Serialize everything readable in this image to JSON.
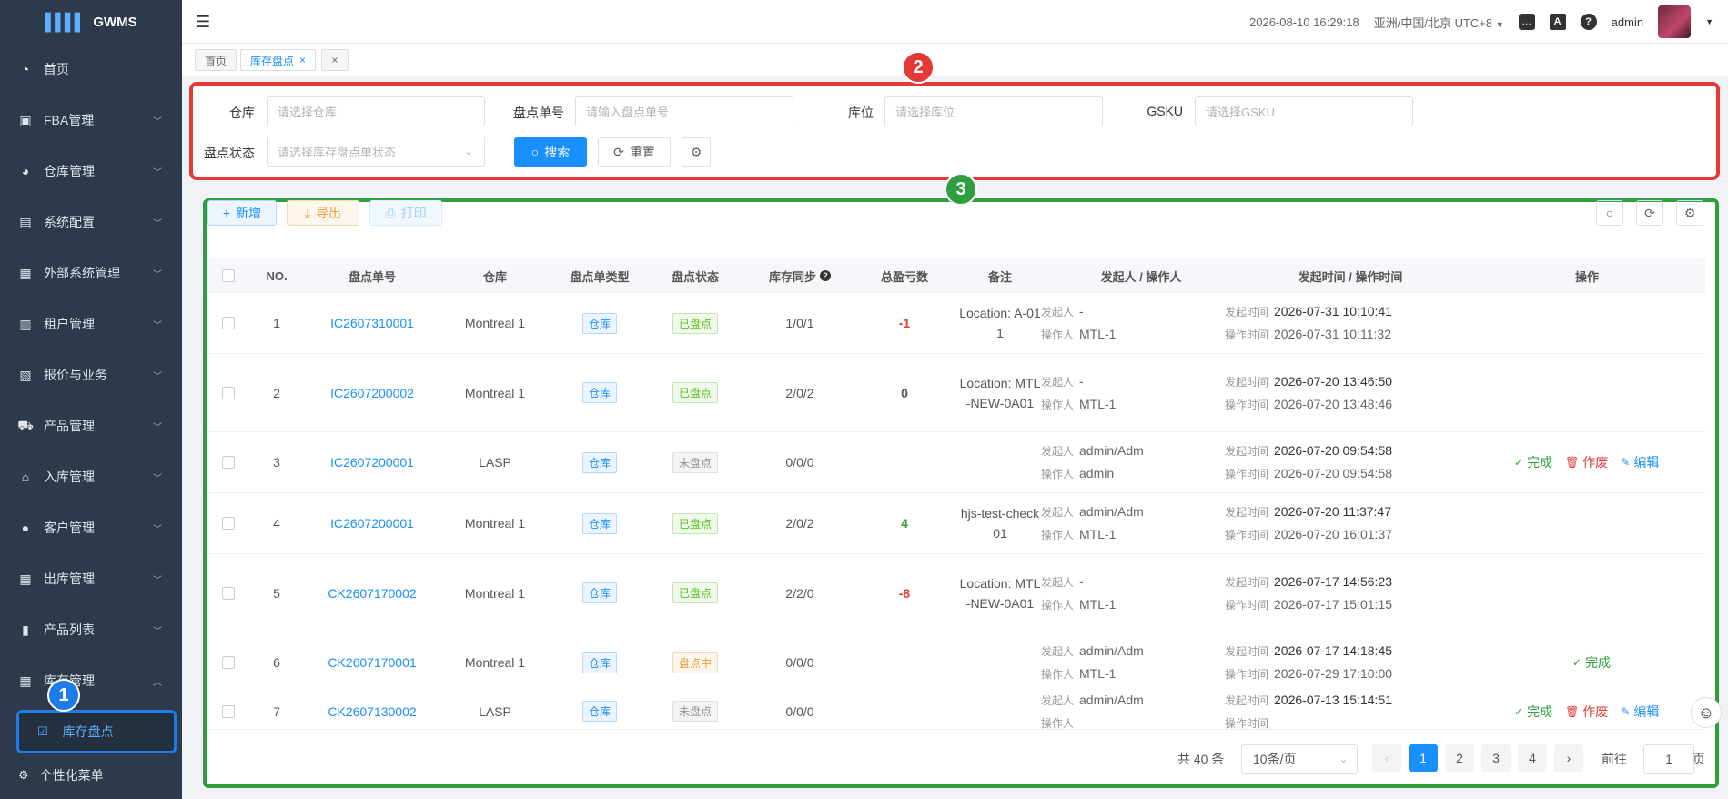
{
  "app": {
    "name": "GWMS"
  },
  "sidebar": {
    "items": [
      {
        "label": "首页",
        "icon": "dashboard-icon"
      },
      {
        "label": "FBA管理",
        "icon": "fba-icon"
      },
      {
        "label": "仓库管理",
        "icon": "warehouse-icon"
      },
      {
        "label": "系统配置",
        "icon": "config-icon"
      },
      {
        "label": "外部系统管理",
        "icon": "grid-icon"
      },
      {
        "label": "租户管理",
        "icon": "chart-icon"
      },
      {
        "label": "报价与业务",
        "icon": "quote-icon"
      },
      {
        "label": "产品管理",
        "icon": "cart-icon"
      },
      {
        "label": "入库管理",
        "icon": "home-icon"
      },
      {
        "label": "客户管理",
        "icon": "user-icon"
      },
      {
        "label": "出库管理",
        "icon": "grid-icon"
      },
      {
        "label": "产品列表",
        "icon": "book-icon"
      },
      {
        "label": "库存管理",
        "icon": "table-icon"
      }
    ],
    "active_sub": "库存盘点",
    "bottom": "个性化菜单"
  },
  "topbar": {
    "datetime": "2026-08-10 16:29:18",
    "timezone": "亚洲/中国/北京 UTC+8",
    "user": "admin"
  },
  "tabs": [
    {
      "label": "首页"
    },
    {
      "label": "库存盘点"
    }
  ],
  "annotations": [
    "1",
    "2",
    "3"
  ],
  "filters": {
    "warehouse_label": "仓库",
    "warehouse_ph": "请选择仓库",
    "order_label": "盘点单号",
    "order_ph": "请输入盘点单号",
    "location_label": "库位",
    "location_ph": "请选择库位",
    "gsku_label": "GSKU",
    "gsku_ph": "请选择GSKU",
    "status_label": "盘点状态",
    "status_ph": "请选择库存盘点单状态",
    "search": "搜索",
    "reset": "重置"
  },
  "toolbar": {
    "add": "新增",
    "export": "导出",
    "print": "打印"
  },
  "table": {
    "headers": [
      "NO.",
      "盘点单号",
      "仓库",
      "盘点单类型",
      "盘点状态",
      "库存同步",
      "总盈亏数",
      "备注",
      "发起人 / 操作人",
      "发起时间 / 操作时间",
      "操作"
    ],
    "initiator_key": "发起人",
    "operator_key": "操作人",
    "start_key": "发起时间",
    "op_key": "操作时间",
    "rows": [
      {
        "no": "1",
        "order": "IC2607310001",
        "warehouse": "Montreal 1",
        "type": "仓库",
        "status": "已盘点",
        "status_kind": "done",
        "sync": "1/0/1",
        "diff": "-1",
        "diff_color": "#e53935",
        "note": "Location: A-011",
        "initiator": "-",
        "operator": "MTL-1",
        "start": "2026-07-31 10:10:41",
        "op_time": "2026-07-31 10:11:32",
        "actions": []
      },
      {
        "no": "2",
        "order": "IC2607200002",
        "warehouse": "Montreal 1",
        "type": "仓库",
        "status": "已盘点",
        "status_kind": "done",
        "sync": "2/0/2",
        "diff": "0",
        "diff_color": "#555",
        "note": "Location: MTL-NEW-0A01",
        "initiator": "-",
        "operator": "MTL-1",
        "start": "2026-07-20 13:46:50",
        "op_time": "2026-07-20 13:48:46",
        "actions": []
      },
      {
        "no": "3",
        "order": "IC2607200001",
        "warehouse": "LASP",
        "type": "仓库",
        "status": "未盘点",
        "status_kind": "not",
        "sync": "0/0/0",
        "diff": "",
        "diff_color": "#555",
        "note": "",
        "initiator": "admin/Adm",
        "operator": "admin",
        "start": "2026-07-20 09:54:58",
        "op_time": "2026-07-20 09:54:58",
        "actions": [
          "完成",
          "作废",
          "编辑"
        ]
      },
      {
        "no": "4",
        "order": "IC2607200001",
        "warehouse": "Montreal 1",
        "type": "仓库",
        "status": "已盘点",
        "status_kind": "done",
        "sync": "2/0/2",
        "diff": "4",
        "diff_color": "#2e9e3e",
        "note": "hjs-test-check01",
        "initiator": "admin/Adm",
        "operator": "MTL-1",
        "start": "2026-07-20 11:37:47",
        "op_time": "2026-07-20 16:01:37",
        "actions": []
      },
      {
        "no": "5",
        "order": "CK2607170002",
        "warehouse": "Montreal 1",
        "type": "仓库",
        "status": "已盘点",
        "status_kind": "done",
        "sync": "2/2/0",
        "diff": "-8",
        "diff_color": "#e53935",
        "note": "Location: MTL-NEW-0A01",
        "initiator": "-",
        "operator": "MTL-1",
        "start": "2026-07-17 14:56:23",
        "op_time": "2026-07-17 15:01:15",
        "actions": []
      },
      {
        "no": "6",
        "order": "CK2607170001",
        "warehouse": "Montreal 1",
        "type": "仓库",
        "status": "盘点中",
        "status_kind": "ing",
        "sync": "0/0/0",
        "diff": "",
        "diff_color": "#555",
        "note": "",
        "initiator": "admin/Adm",
        "operator": "MTL-1",
        "start": "2026-07-17 14:18:45",
        "op_time": "2026-07-29 17:10:00",
        "actions": [
          "完成"
        ]
      },
      {
        "no": "7",
        "order": "CK2607130002",
        "warehouse": "LASP",
        "type": "仓库",
        "status": "未盘点",
        "status_kind": "not",
        "sync": "0/0/0",
        "diff": "",
        "diff_color": "#555",
        "note": "",
        "initiator": "admin/Adm",
        "operator": "",
        "start": "2026-07-13 15:14:51",
        "op_time": "",
        "actions": [
          "完成",
          "作废",
          "编辑"
        ]
      }
    ]
  },
  "pagination": {
    "total": "共 40 条",
    "page_size": "10条/页",
    "pages": [
      "1",
      "2",
      "3",
      "4"
    ],
    "goto_label": "前往",
    "goto_value": "1",
    "goto_suffix": "页"
  },
  "colors": {
    "primary": "#1890ff",
    "danger": "#e53935",
    "success": "#2e9e3e",
    "sidebar": "#2d3a4b"
  }
}
